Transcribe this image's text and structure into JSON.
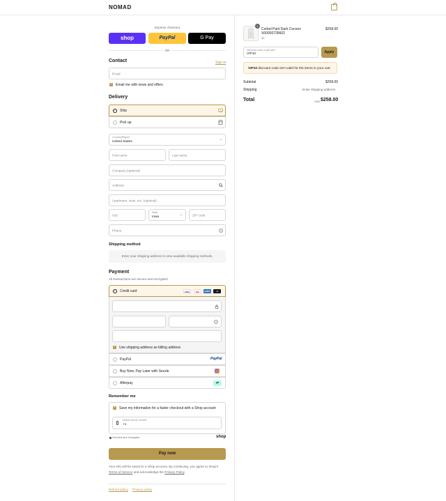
{
  "header": {
    "brand": "NOMAD",
    "cart_icon": "bag-icon"
  },
  "express": {
    "title": "Express checkout",
    "shop_label": "shop",
    "paypal_label": "PayPal",
    "gpay_label": "G Pay",
    "or_label": "OR"
  },
  "contact": {
    "heading": "Contact",
    "sign_in": "Sign in",
    "email_placeholder": "Email",
    "news_label": "Email me with news and offers"
  },
  "delivery": {
    "heading": "Delivery",
    "ship_label": "Ship",
    "pickup_label": "Pick up",
    "country_label": "Country/Region",
    "country_value": "United States",
    "first_name": "First name",
    "last_name": "Last name",
    "company": "Company (optional)",
    "address": "Address",
    "apartment": "Apartment, suite, etc. (optional)",
    "city": "City",
    "state_label": "State",
    "state_value": "Iowa",
    "zip": "ZIP code",
    "phone": "Phone"
  },
  "shipping_method": {
    "heading": "Shipping method",
    "message": "Enter your shipping address to view available shipping methods."
  },
  "payment": {
    "heading": "Payment",
    "subtitle": "All transactions are secure and encrypted.",
    "credit_card": "Credit card",
    "cards": [
      "VISA",
      "MC",
      "AMEX",
      "+4"
    ],
    "billing_label": "Use shipping address as billing address",
    "paypal": "PayPal",
    "paypal_logo": "PayPal",
    "sezzle": "Buy Now, Pay Later with Sezzle",
    "afterpay": "Afterpay"
  },
  "remember": {
    "heading": "Remember me",
    "save_label": "Save my information for a faster checkout with a Shop account",
    "phone_label": "Mobile phone number",
    "phone_value": "+1",
    "secure_label": "Secured and encrypted",
    "shop_logo": "shop"
  },
  "pay_now": "Pay now",
  "legal": {
    "text_before": "Your info will be saved to a Shop account. By continuing, you agree to Shop's ",
    "terms": "Terms of Service",
    "text_mid": " and acknowledge the ",
    "privacy": "Privacy Policy",
    "text_end": "."
  },
  "footer": {
    "refund": "Refund policy",
    "privacy": "Privacy policy"
  },
  "summary": {
    "qty_badge": "1",
    "product_name": "Corbel Pant Dark Cocoon",
    "product_sku": "X00000728602",
    "product_size": "30",
    "product_price": "$258.00",
    "discount_label": "Discount code or gift card",
    "discount_value": "VIP10",
    "apply": "Apply",
    "alert_code": "VIP10",
    "alert_text": " discount code isn't valid for the items in your cart",
    "subtotal_label": "Subtotal",
    "subtotal_value": "$258.00",
    "shipping_label": "Shipping",
    "shipping_value": "Enter shipping address",
    "total_label": "Total",
    "currency": "USD",
    "total_value": "$258.00"
  },
  "colors": {
    "accent": "#b79a4f",
    "shop": "#5a31f4",
    "paypal": "#ffc439",
    "alert_bg": "#fdf6e8"
  }
}
